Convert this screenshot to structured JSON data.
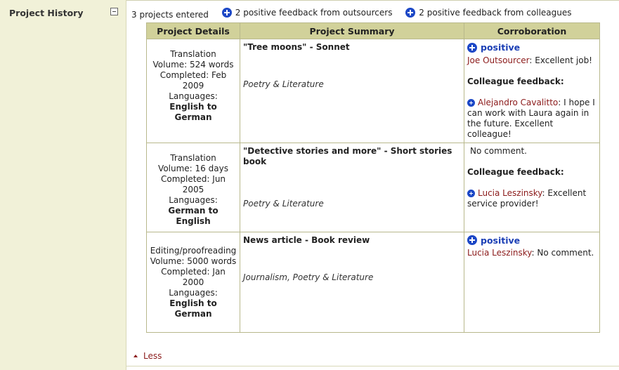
{
  "section": {
    "title": "Project History"
  },
  "summary": {
    "entered": "3 projects entered",
    "outsourcers": "2 positive feedback from outsourcers",
    "colleagues": "2 positive feedback from colleagues"
  },
  "table": {
    "headers": [
      "Project Details",
      "Project Summary",
      "Corroboration"
    ],
    "rows": [
      {
        "type": "Translation",
        "volume": "Volume: 524 words",
        "completed": "Completed: Feb 2009",
        "languages_label": "Languages:",
        "languages": "English to German",
        "title": "\"Tree moons\"",
        "title_suffix": " - Sonnet",
        "field": "Poetry & Literature",
        "rating": "positive",
        "outsourcer": "Joe Outsourcer",
        "outsourcer_comment": ": Excellent job!",
        "colleague_heading": "Colleague feedback:",
        "colleague": "Alejandro Cavalitto",
        "colleague_comment": ": I hope I can work with Laura again in the future. Excellent colleague!"
      },
      {
        "type": "Translation",
        "volume": "Volume: 16 days",
        "completed": "Completed: Jun 2005",
        "languages_label": "Languages:",
        "languages": "German to English",
        "title": "\"Detective stories and more\"",
        "title_suffix": " - Short stories book",
        "field": "Poetry & Literature",
        "no_comment": "No comment.",
        "colleague_heading": "Colleague feedback:",
        "colleague": "Lucia Leszinsky",
        "colleague_comment": ": Excellent service provider!"
      },
      {
        "type": "Editing/proofreading",
        "volume": "Volume: 5000 words",
        "completed": "Completed: Jan 2000",
        "languages_label": "Languages:",
        "languages": "English to German",
        "title": "News article",
        "title_suffix": " - Book review",
        "field": "Journalism, Poetry & Literature",
        "rating": "positive",
        "outsourcer": "Lucia Leszinsky",
        "outsourcer_comment": ": No comment."
      }
    ]
  },
  "footer": {
    "less": "Less"
  },
  "icons": {
    "collapse": "minus-box-icon",
    "positive": "plus-circle-icon",
    "less": "up-arrow-icon"
  },
  "colors": {
    "sidebar": "#f1f1d8",
    "header": "#d1d19a",
    "link": "#8b1a1a",
    "positive": "#1b3fb5"
  }
}
